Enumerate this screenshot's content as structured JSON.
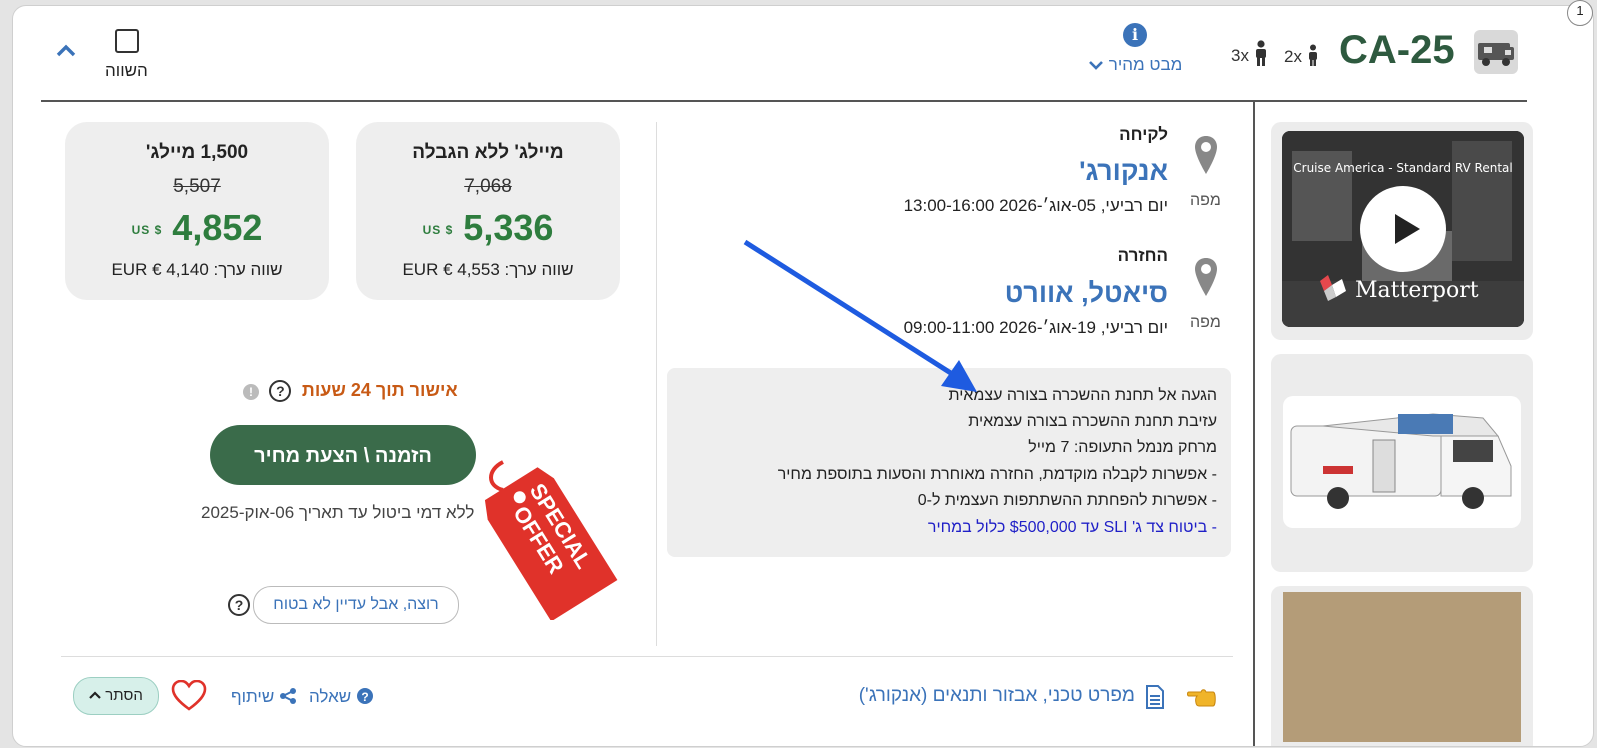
{
  "header": {
    "model_code": "CA-25",
    "adults": "2x",
    "children": "3x",
    "quick_view": "מבט מהיר",
    "compare_label": "השווה",
    "page_number": "1"
  },
  "pickup": {
    "heading": "לקיחה",
    "city": "אנקורג'",
    "date": "יום רביעי, 05-אוג׳-2026 13:00-16:00",
    "map_label": "מפה"
  },
  "dropoff": {
    "heading": "החזרה",
    "city": "סיאטל, אוורט",
    "date": "יום רביעי, 19-אוג׳-2026 09:00-11:00",
    "map_label": "מפה"
  },
  "info_lines": [
    "הגעה אל תחנת ההשכרה בצורה עצמאית",
    "עזיבת תחנת ההשכרה בצורה עצמאית",
    "מרחק מנמל התעופה: 7 מייל",
    "- אפשרות לקבלה מוקדמת, החזרה מאוחרת והסעות בתוספת מחיר",
    "- אפשרות להפחתת ההשתתפות העצמית ל-0",
    "- ביטוח צד ג' SLI עד $500,000 כלול במחיר"
  ],
  "price_unlimited": {
    "title": "מיילג' ללא הגבלה",
    "old_price": "7,068",
    "price": "5,336",
    "currency": "US $",
    "eur": "שווה ערך: EUR € 4,553"
  },
  "price_limited": {
    "title": "1,500 מיילג'",
    "old_price": "5,507",
    "price": "4,852",
    "currency": "US $",
    "eur": "שווה ערך: EUR € 4,140"
  },
  "approval": "אישור תוך 24 שעות",
  "book_button": "הזמנה \\ הצעת מחיר",
  "cancel_note": "ללא דמי ביטול עד תאריך 06-אוק-2025",
  "maybe_button": "רוצה, אבל עדיין לא בטוח",
  "special_offer": [
    "SPECIAL",
    "OFFER"
  ],
  "footer": {
    "spec_link": "מפרט טכני, אבזור ותנאים (אנקורג')",
    "question": "שאלה",
    "share": "שיתוף",
    "hide": "הסתר"
  },
  "video": {
    "title": "Cruise America - Standard RV Rental",
    "brand": "Matterport"
  },
  "colors": {
    "brand_green": "#2e5a3f",
    "price_green": "#2e7d3e",
    "link_blue": "#3b73b9",
    "approval_orange": "#c85a15",
    "offer_red": "#e0322a",
    "arrow_blue": "#1e5be0"
  }
}
